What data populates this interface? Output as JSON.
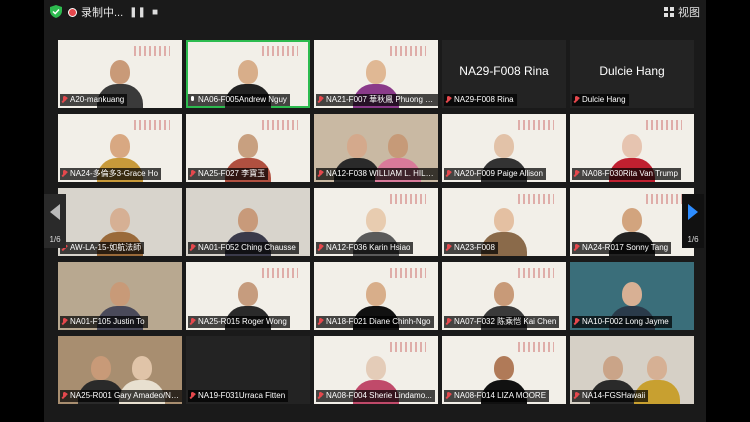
{
  "top_bar": {
    "recording_label": "录制中...",
    "pause": "❚❚",
    "stop": "■",
    "view_label": "视图"
  },
  "pager": {
    "left_page": "1/6",
    "right_page": "1/6"
  },
  "tiles": [
    {
      "name": "A20-mankuang",
      "muted": true
    },
    {
      "name": "NA06-F005Andrew Nguy",
      "muted": false
    },
    {
      "name": "NA21-F007 華秋鳳 Phuong Su...",
      "muted": true
    },
    {
      "name": "NA29-F008 Rina",
      "muted": true,
      "big": "NA29-F008 Rina"
    },
    {
      "name": "Dulcie Hang",
      "muted": true,
      "big": "Dulcie Hang"
    },
    {
      "name": "NA24-多倫多3-Grace Ho",
      "muted": true
    },
    {
      "name": "NA25-F027 李寶玉",
      "muted": true
    },
    {
      "name": "NA12-F038 WILLIAM L. HILL/...",
      "muted": true
    },
    {
      "name": "NA20-F009 Paige Allison",
      "muted": true
    },
    {
      "name": "NA08-F030Rita Van Trump",
      "muted": true
    },
    {
      "name": "AW-LA-15-如航法師",
      "muted": true
    },
    {
      "name": "NA01-F052 Ching Chausse",
      "muted": true
    },
    {
      "name": "NA12-F036 Karin Hsiao",
      "muted": true
    },
    {
      "name": "NA23-F008",
      "muted": true
    },
    {
      "name": "NA24-R017 Sonny Tang",
      "muted": true
    },
    {
      "name": "NA01-F105 Justin To",
      "muted": true
    },
    {
      "name": "NA25-R015 Roger Wong",
      "muted": true
    },
    {
      "name": "NA18-F021 Diane Chinh-Ngo",
      "muted": true
    },
    {
      "name": "NA07-F032 陈乘恺 Kai Chen",
      "muted": true
    },
    {
      "name": "NA10-F002 Long Jayme",
      "muted": true
    },
    {
      "name": "NA25-R001 Gary Amadeo/NA...",
      "muted": true
    },
    {
      "name": "NA19-F031Urraca Fitten",
      "muted": true
    },
    {
      "name": "NA08-F004    Sherie Lindamo...",
      "muted": true
    },
    {
      "name": "NA08-F014 LIZA MOORE",
      "muted": true
    },
    {
      "name": "NA14-FGSHawaii",
      "muted": true
    }
  ]
}
